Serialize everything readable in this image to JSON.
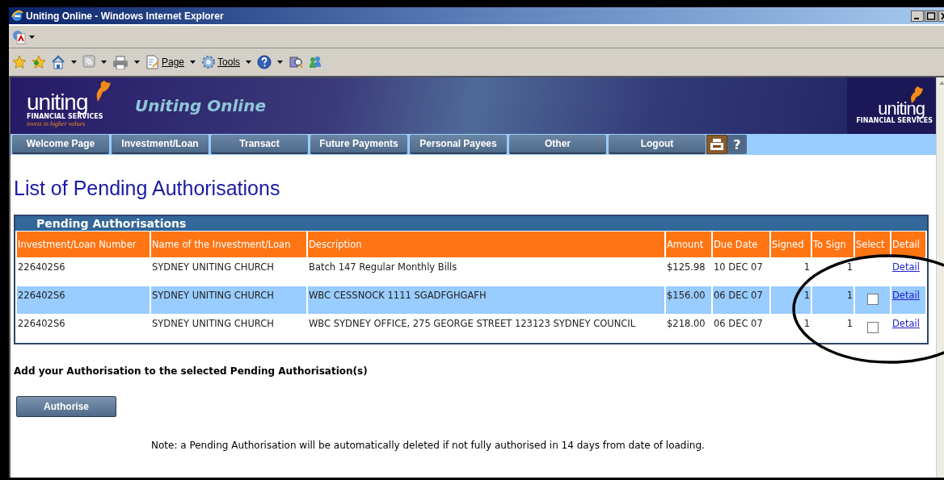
{
  "window": {
    "title": "Uniting Online - Windows Internet Explorer"
  },
  "command_bar": {
    "items": [
      {
        "kind": "pdf"
      },
      {
        "kind": "dropdown"
      }
    ]
  },
  "favorites_bar": {
    "items": [
      {
        "kind": "star"
      },
      {
        "kind": "add-star"
      },
      {
        "kind": "home"
      },
      {
        "kind": "dropdown"
      },
      {
        "kind": "feed"
      },
      {
        "kind": "dropdown"
      },
      {
        "kind": "print"
      },
      {
        "kind": "dropdown"
      },
      {
        "kind": "page",
        "label": "Page"
      },
      {
        "kind": "dropdown"
      },
      {
        "kind": "gear",
        "label": "Tools"
      },
      {
        "kind": "dropdown"
      },
      {
        "kind": "help"
      },
      {
        "kind": "dropdown"
      },
      {
        "kind": "research"
      },
      {
        "kind": "messenger"
      }
    ]
  },
  "banner": {
    "logo": {
      "name": "uniting",
      "sub": "FINANCIAL SERVICES",
      "tagline": "invest in higher values"
    },
    "title": "Uniting Online",
    "right_logo": {
      "name": "uniting",
      "sub": "FINANCIAL SERVICES"
    }
  },
  "nav": {
    "items": [
      {
        "kind": "link",
        "label": "Welcome Page"
      },
      {
        "kind": "link",
        "label": "Investment/Loan"
      },
      {
        "kind": "link",
        "label": "Transact"
      },
      {
        "kind": "link",
        "label": "Future Payments"
      },
      {
        "kind": "link",
        "label": "Personal Payees"
      },
      {
        "kind": "link",
        "label": "Other"
      },
      {
        "kind": "link",
        "label": "Logout"
      },
      {
        "kind": "print"
      },
      {
        "kind": "help",
        "label": "?"
      }
    ]
  },
  "heading": "List of Pending Authorisations",
  "panel": {
    "title": "Pending Authorisations",
    "columns": [
      {
        "label": "Investment/Loan Number"
      },
      {
        "label": "Name of the Investment/Loan"
      },
      {
        "label": "Description"
      },
      {
        "label": "Amount"
      },
      {
        "label": "Due Date"
      },
      {
        "label": "Signed"
      },
      {
        "label": "To Sign"
      },
      {
        "label": "Select"
      },
      {
        "label": "Detail"
      }
    ],
    "rows": [
      {
        "highlighted": false,
        "number": "226402S6",
        "name": "SYDNEY UNITING CHURCH",
        "description": "Batch 147 Regular Monthly Bills",
        "amount": "$125.98",
        "due_date": "10 DEC 07",
        "signed": "1",
        "to_sign": "1",
        "detail": "Detail"
      },
      {
        "highlighted": true,
        "number": "226402S6",
        "name": "SYDNEY UNITING CHURCH",
        "description": "WBC CESSNOCK 1111 SGADFGHGAFH",
        "amount": "$156.00",
        "due_date": "06 DEC 07",
        "signed": "1",
        "to_sign": "1",
        "select": {
          "checked": false
        },
        "detail": "Detail"
      },
      {
        "highlighted": false,
        "number": "226402S6",
        "name": "SYDNEY UNITING CHURCH",
        "description": "WBC SYDNEY OFFICE, 275 GEORGE STREET 123123 SYDNEY COUNCIL",
        "amount": "$218.00",
        "due_date": "06 DEC 07",
        "signed": "1",
        "to_sign": "1",
        "select": {
          "checked": false
        },
        "detail": "Detail"
      }
    ]
  },
  "instruction": "Add your Authorisation to the selected Pending Authorisation(s)",
  "button": "Authorise",
  "note": "Note: a Pending Authorisation will be automatically deleted if not fully authorised in 14 days from date of loading.",
  "annotation": {
    "kind": "ellipse"
  }
}
